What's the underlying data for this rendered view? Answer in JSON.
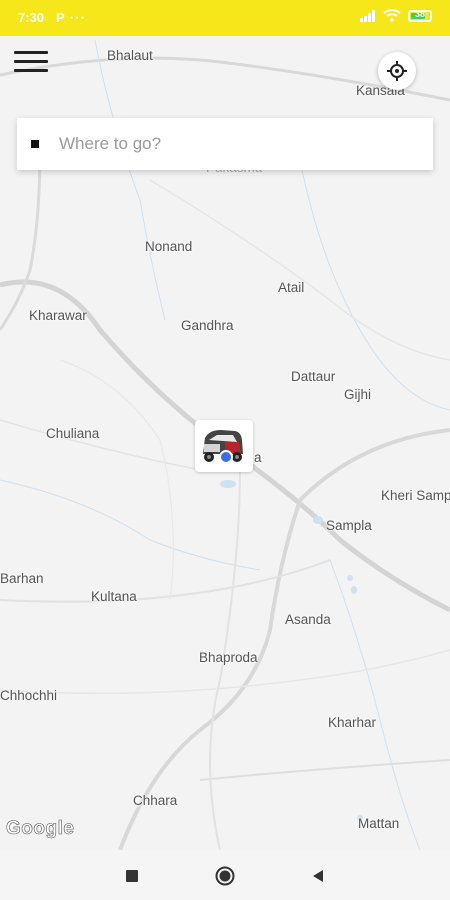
{
  "status_bar": {
    "time": "7:30",
    "app_icons": "P ···",
    "battery_level": "38",
    "icons": [
      "signal-icon",
      "wifi-icon",
      "battery-icon"
    ]
  },
  "map": {
    "places": [
      {
        "key": "bhalaut",
        "label": "Bhalaut"
      },
      {
        "key": "kansala",
        "label": "Kansala"
      },
      {
        "key": "pakasma",
        "label": "Pakasma"
      },
      {
        "key": "nonand",
        "label": "Nonand"
      },
      {
        "key": "atail",
        "label": "Atail"
      },
      {
        "key": "kharawar",
        "label": "Kharawar"
      },
      {
        "key": "gandhra",
        "label": "Gandhra"
      },
      {
        "key": "dattaur",
        "label": "Dattaur"
      },
      {
        "key": "gijhi",
        "label": "Gijhi"
      },
      {
        "key": "chuliana",
        "label": "Chuliana"
      },
      {
        "key": "ismaila",
        "label": "a"
      },
      {
        "key": "kheri-sampla",
        "label": "Kheri Samp"
      },
      {
        "key": "sampla",
        "label": "Sampla"
      },
      {
        "key": "barhan",
        "label": "Barhan"
      },
      {
        "key": "kultana",
        "label": "Kultana"
      },
      {
        "key": "asanda",
        "label": "Asanda"
      },
      {
        "key": "bhaproda",
        "label": "Bhaproda"
      },
      {
        "key": "chhochhi",
        "label": "Chhochhi"
      },
      {
        "key": "kharhar",
        "label": "Kharhar"
      },
      {
        "key": "chhara",
        "label": "Chhara"
      },
      {
        "key": "mattan",
        "label": "Mattan"
      }
    ],
    "attribution": "Google"
  },
  "search": {
    "placeholder": "Where to go?"
  },
  "icons": {
    "menu": "hamburger-menu-icon",
    "locate": "crosshair-locate-icon",
    "vehicle": "auto-rickshaw-icon"
  },
  "nav_bar": {
    "buttons": [
      "recents-square-icon",
      "home-circle-icon",
      "back-triangle-icon"
    ]
  },
  "colors": {
    "status_bar": "#f6e71b",
    "user_location": "#3b6fe0",
    "map_background": "#f3f3f3"
  }
}
